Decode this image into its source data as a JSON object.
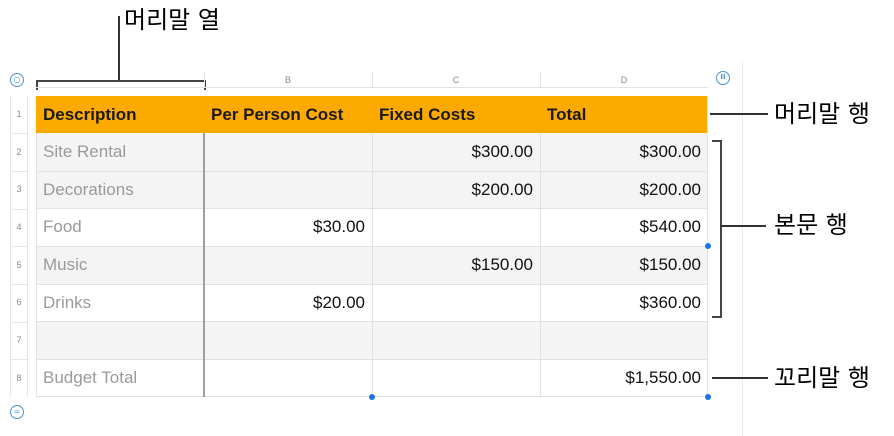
{
  "callouts": {
    "header_column": "머리말 열",
    "header_row": "머리말 행",
    "body_rows": "본문 행",
    "footer_row": "꼬리말 행"
  },
  "column_letters": [
    "B",
    "C",
    "D"
  ],
  "row_numbers": [
    "1",
    "2",
    "3",
    "4",
    "5",
    "6",
    "7",
    "8"
  ],
  "table": {
    "headers": [
      "Description",
      "Per Person Cost",
      "Fixed Costs",
      "Total"
    ],
    "rows": [
      [
        "Site Rental",
        "",
        "$300.00",
        "$300.00"
      ],
      [
        "Decorations",
        "",
        "$200.00",
        "$200.00"
      ],
      [
        "Food",
        "$30.00",
        "",
        "$540.00"
      ],
      [
        "Music",
        "",
        "$150.00",
        "$150.00"
      ],
      [
        "Drinks",
        "$20.00",
        "",
        "$360.00"
      ],
      [
        "",
        "",
        "",
        ""
      ]
    ],
    "footer": [
      "Budget Total",
      "",
      "",
      "$1,550.00"
    ]
  },
  "controls": {
    "select_table_icon": "○",
    "pause_icon": "II",
    "add_row_icon": "="
  },
  "colors": {
    "header_fill": "#fdaa00",
    "selection_handle": "#1a73e8"
  }
}
